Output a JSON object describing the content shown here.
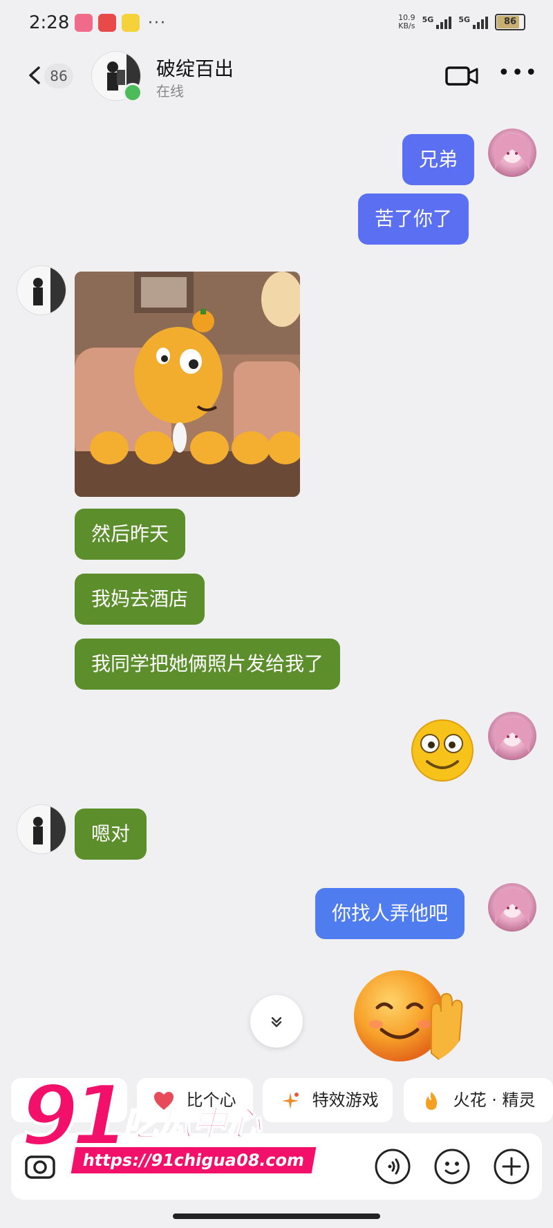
{
  "status_bar": {
    "time": "2:28",
    "net_speed": "10.9\nKB/s",
    "net_speed_top": "10.9",
    "net_speed_bottom": "KB/s",
    "sig1_label": "5G",
    "sig2_label": "5G",
    "battery": "86"
  },
  "header": {
    "back_count": "86",
    "contact_name": "破绽百出",
    "status": "在线"
  },
  "messages": [
    {
      "side": "right",
      "text": "兄弟"
    },
    {
      "side": "right",
      "text": "苦了你了"
    },
    {
      "side": "left",
      "type": "image"
    },
    {
      "side": "left",
      "text": "然后昨天"
    },
    {
      "side": "left",
      "text": "我妈去酒店"
    },
    {
      "side": "left",
      "text": "我同学把她俩照片发给我了"
    },
    {
      "side": "right",
      "type": "emoji"
    },
    {
      "side": "left",
      "text": "嗯对"
    },
    {
      "side": "right",
      "text": "你找人弄他吧"
    },
    {
      "side": "right",
      "type": "emoji"
    }
  ],
  "quick_chips": [
    {
      "label": "比个心",
      "icon": "heart-icon"
    },
    {
      "label": "特效游戏",
      "icon": "sparkle-icon"
    },
    {
      "label": "火花 · 精灵",
      "icon": "fire-sprite-icon"
    }
  ],
  "watermark": {
    "number": "91",
    "title": "吃瓜中心",
    "url": "https://91chigua08.com"
  },
  "colors": {
    "outgoing_bubble": "#5b6ff2",
    "incoming_bubble": "#5c8e2c",
    "watermark": "#f2106a"
  }
}
